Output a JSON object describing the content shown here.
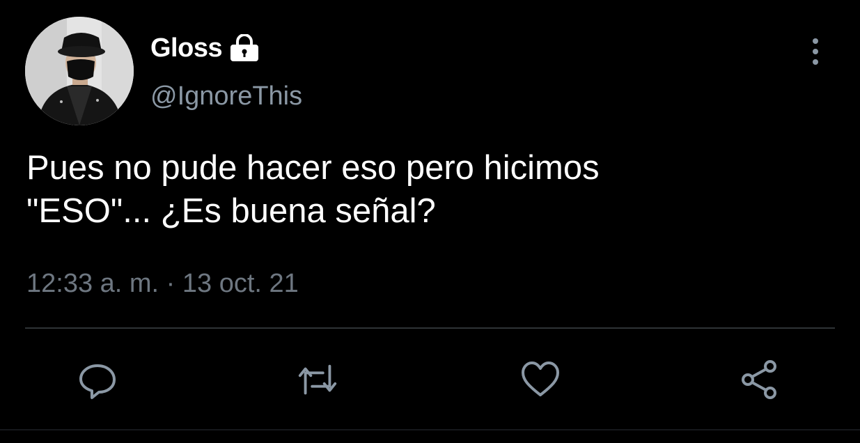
{
  "user": {
    "display_name": "Gloss",
    "handle": "@IgnoreThis",
    "avatar_icon": "user-avatar",
    "protected_icon": "lock-icon"
  },
  "tweet": {
    "text_lines": [
      "Pues no pude hacer eso pero hicimos",
      "\"ESO\"... ¿Es buena señal?"
    ],
    "timestamp": "12:33 a. m. · 13 oct. 21"
  },
  "actions": [
    {
      "name": "reply",
      "icon": "reply-icon"
    },
    {
      "name": "retweet",
      "icon": "retweet-icon"
    },
    {
      "name": "like",
      "icon": "heart-icon"
    },
    {
      "name": "share",
      "icon": "share-icon"
    }
  ],
  "colors": {
    "background": "#000000",
    "text_primary": "#ffffff",
    "text_secondary": "#8b98a5",
    "icon": "#8b98a5",
    "divider": "#2f3336"
  }
}
